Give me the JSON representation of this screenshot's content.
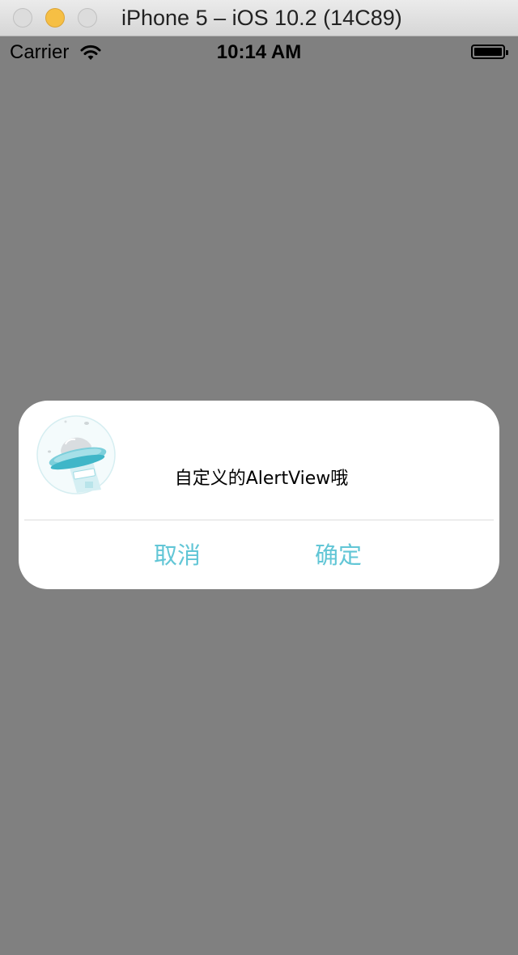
{
  "window": {
    "title": "iPhone 5 – iOS 10.2 (14C89)",
    "buttons": [
      "close-icon",
      "minimize-icon",
      "zoom-icon"
    ]
  },
  "status_bar": {
    "carrier": "Carrier",
    "wifi_icon": "wifi-icon",
    "time": "10:14 AM",
    "battery_icon": "battery-icon",
    "battery_level": 1.0
  },
  "alert": {
    "icon": "ufo-illustration-icon",
    "message": "自定义的AlertView哦",
    "cancel_label": "取消",
    "confirm_label": "确定",
    "accent_color": "#62c6d6"
  },
  "colors": {
    "backdrop": "#808080",
    "alert_background": "#ffffff"
  }
}
